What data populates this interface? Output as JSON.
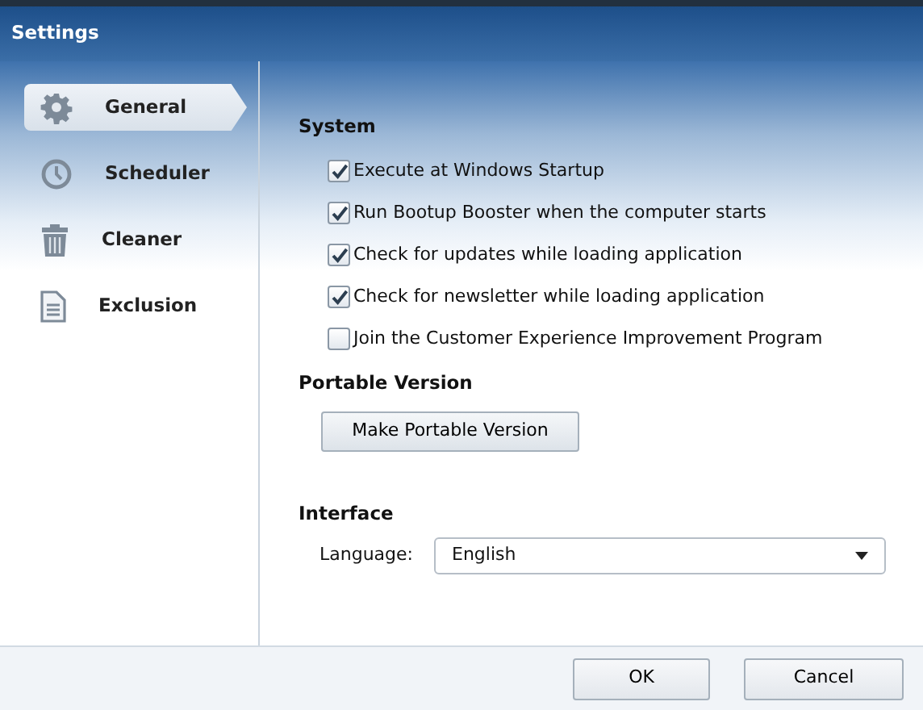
{
  "window": {
    "title": "Settings"
  },
  "sidebar": {
    "items": [
      {
        "label": "General",
        "kind": "gear",
        "selected": true
      },
      {
        "label": "Scheduler",
        "kind": "clock",
        "selected": false
      },
      {
        "label": "Cleaner",
        "kind": "trash",
        "selected": false
      },
      {
        "label": "Exclusion",
        "kind": "document",
        "selected": false
      }
    ]
  },
  "sections": [
    {
      "heading": "System",
      "kind": "checkboxes",
      "options": [
        {
          "label": "Execute at Windows Startup",
          "checked": true
        },
        {
          "label": "Run Bootup Booster when the computer starts",
          "checked": true
        },
        {
          "label": "Check for updates while loading application",
          "checked": true
        },
        {
          "label": "Check for newsletter while loading application",
          "checked": true
        },
        {
          "label": "Join the Customer Experience Improvement Program",
          "checked": false
        }
      ]
    },
    {
      "heading": "Portable Version",
      "kind": "button",
      "button": "Make Portable Version"
    },
    {
      "heading": "Interface",
      "kind": "select",
      "label": "Language:",
      "value": "English"
    }
  ],
  "buttons": [
    "OK",
    "Cancel"
  ]
}
